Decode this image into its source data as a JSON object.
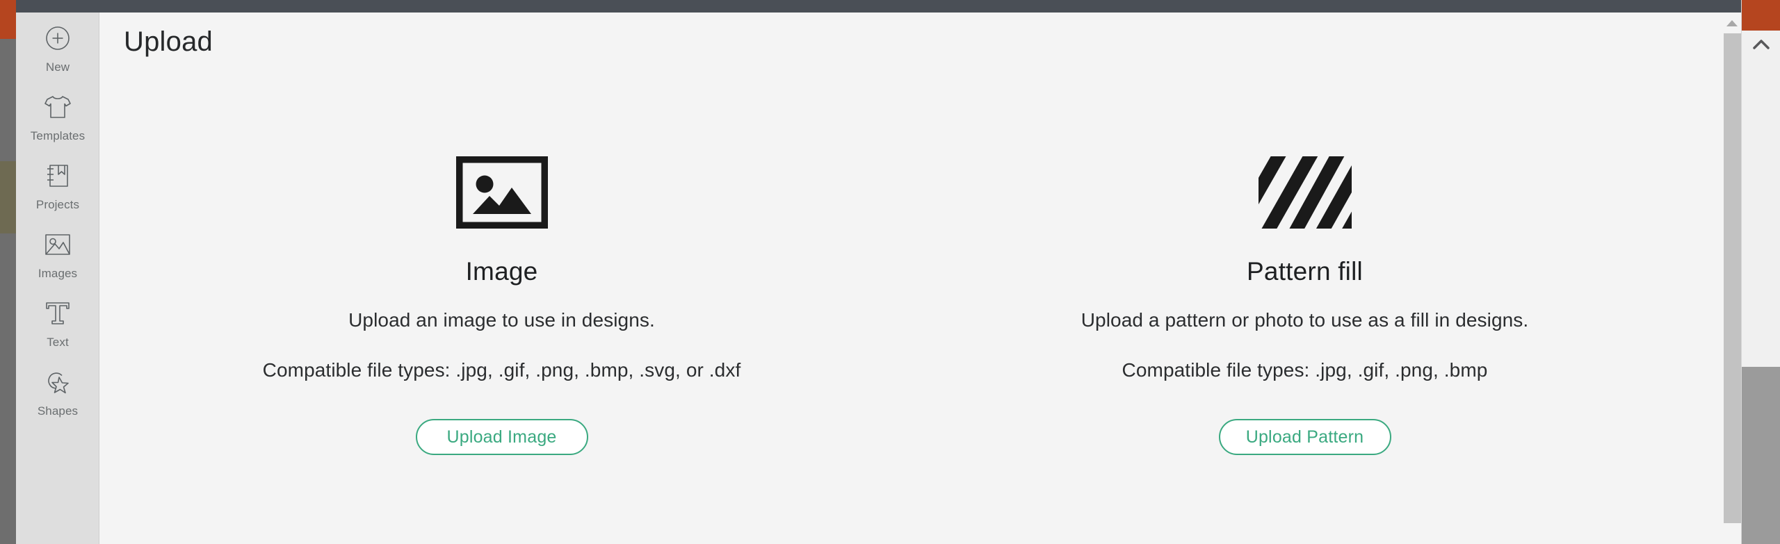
{
  "window": {
    "topbar_color": "#4a4f56",
    "sidebar_color": "#dedede",
    "content_color": "#f4f4f4",
    "accent_color": "#3aa980",
    "edge_orange": "#b5451f",
    "edge_gray": "#6e6e6e",
    "edge_olive": "#6e6a52"
  },
  "sidebar": {
    "items": [
      {
        "label": "New",
        "icon": "circle-plus-icon"
      },
      {
        "label": "Templates",
        "icon": "tshirt-icon"
      },
      {
        "label": "Projects",
        "icon": "notebook-bookmark-icon"
      },
      {
        "label": "Images",
        "icon": "picture-icon"
      },
      {
        "label": "Text",
        "icon": "text-t-icon"
      },
      {
        "label": "Shapes",
        "icon": "shapes-star-circle-icon"
      }
    ]
  },
  "main": {
    "page_title": "Upload",
    "cards": [
      {
        "icon": "image-frame-icon",
        "title": "Image",
        "description": "Upload an image to use in designs.",
        "file_types": "Compatible file types: .jpg, .gif, .png, .bmp, .svg, or .dxf",
        "button_label": "Upload Image"
      },
      {
        "icon": "diagonal-stripes-icon",
        "title": "Pattern fill",
        "description": "Upload a pattern or photo to use as a fill in designs.",
        "file_types": "Compatible file types: .jpg, .gif, .png, .bmp",
        "button_label": "Upload Pattern"
      }
    ]
  },
  "scrollbars": {
    "inner": {
      "up_arrow": "scroll-up-arrow"
    },
    "outer": {
      "up_arrow": "scroll-up-chevron"
    }
  }
}
